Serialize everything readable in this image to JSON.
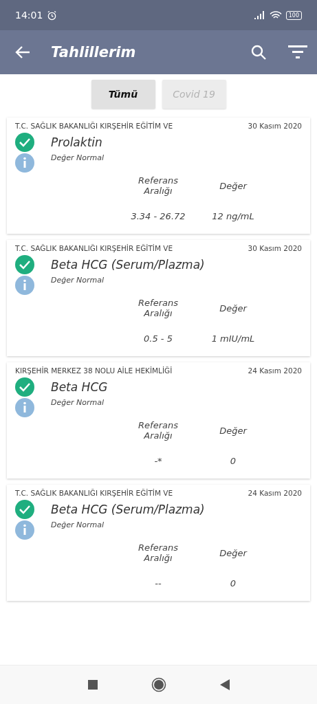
{
  "status_bar": {
    "time": "14:01",
    "battery": "100"
  },
  "app_bar": {
    "title": "Tahlillerim"
  },
  "tabs": [
    {
      "label": "Tümü",
      "selected": true
    },
    {
      "label": "Covid 19",
      "selected": false
    }
  ],
  "results": [
    {
      "institution": "T.C. SAĞLIK BAKANLIĞI KIRŞEHİR EĞİTİM VE",
      "date": "30 Kasım 2020",
      "test": "Prolaktin",
      "status": "Değer Normal",
      "range_header": "Referans Aralığı",
      "value_header": "Değer",
      "range": "3.34 - 26.72",
      "value": "12 ng/mL"
    },
    {
      "institution": "T.C. SAĞLIK BAKANLIĞI KIRŞEHİR EĞİTİM VE",
      "date": "30 Kasım 2020",
      "test": "Beta HCG (Serum/Plazma)",
      "status": "Değer Normal",
      "range_header": "Referans Aralığı",
      "value_header": "Değer",
      "range": "0.5 - 5",
      "value": "1 mIU/mL"
    },
    {
      "institution": "KIRŞEHİR MERKEZ 38 NOLU AİLE HEKİMLİĞİ",
      "date": "24 Kasım 2020",
      "test": "Beta HCG",
      "status": "Değer Normal",
      "range_header": "Referans Aralığı",
      "value_header": "Değer",
      "range": "-*",
      "value": "0"
    },
    {
      "institution": "T.C. SAĞLIK BAKANLIĞI KIRŞEHİR EĞİTİM VE",
      "date": "24 Kasım 2020",
      "test": "Beta HCG (Serum/Plazma)",
      "status": "Değer Normal",
      "range_header": "Referans Aralığı",
      "value_header": "Değer",
      "range": "--",
      "value": "0"
    }
  ]
}
